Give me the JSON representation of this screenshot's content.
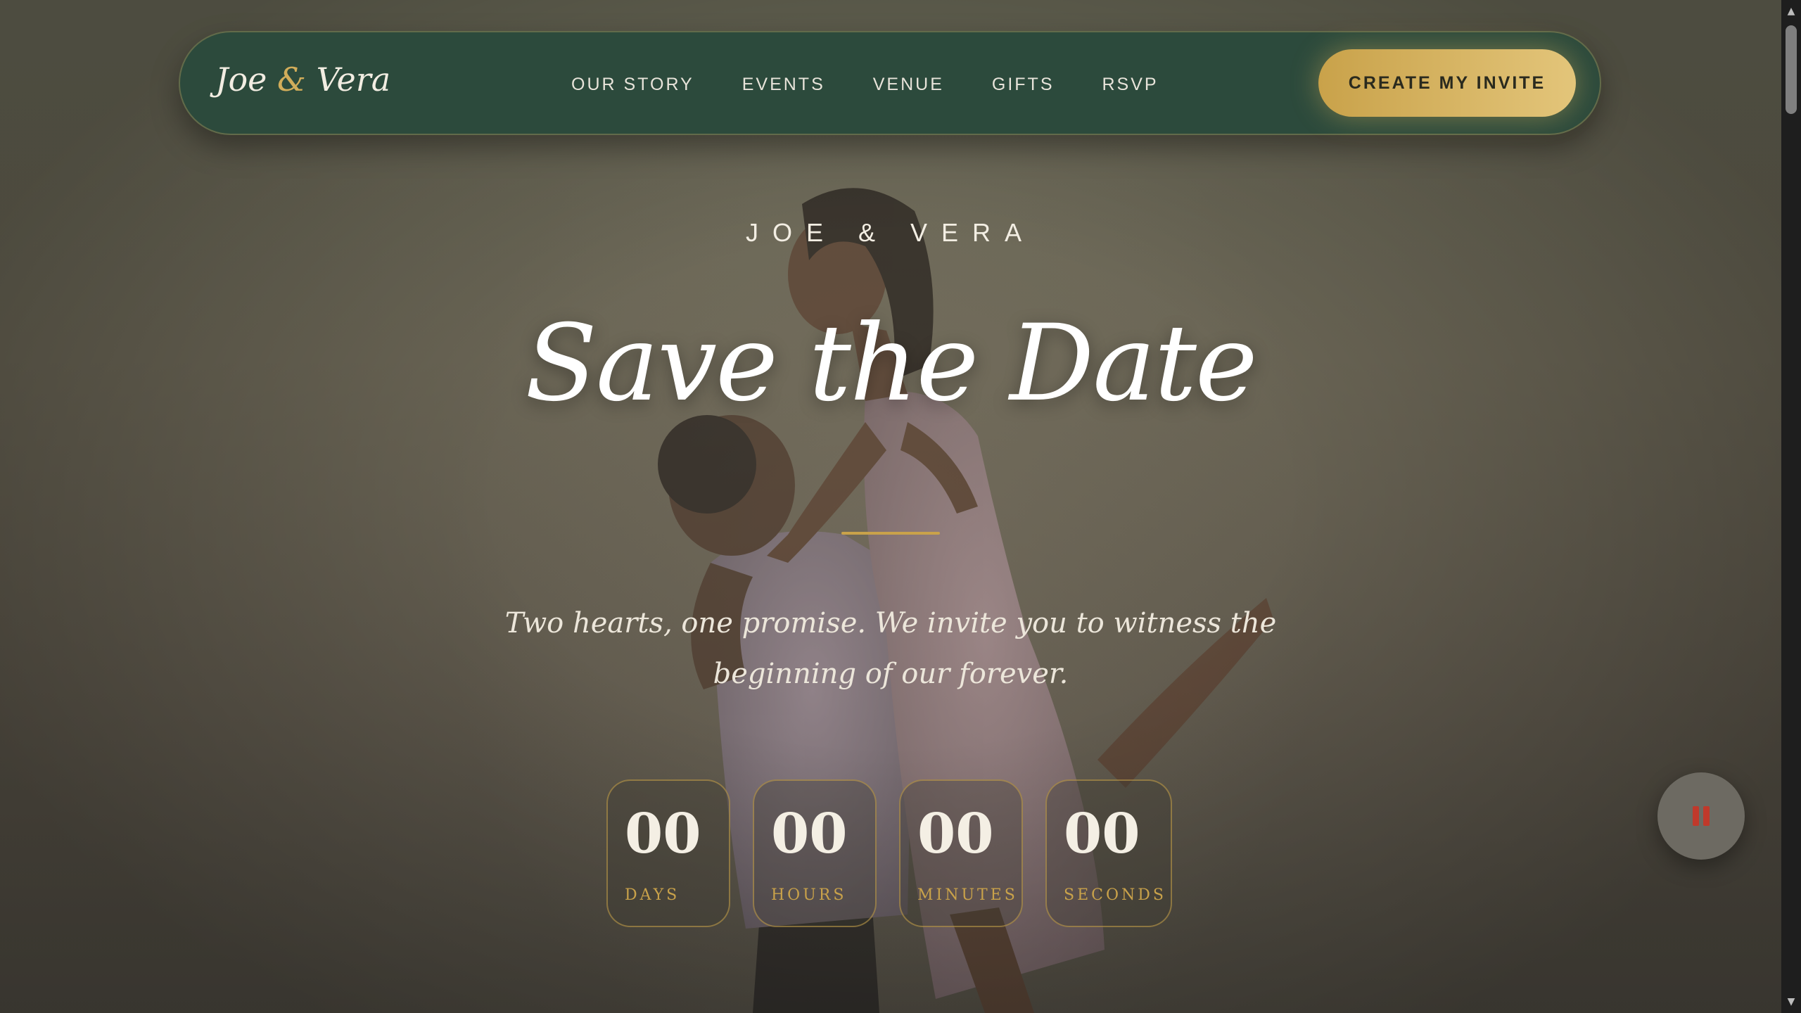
{
  "navbar": {
    "logo_first": "Joe",
    "logo_amp": "&",
    "logo_second": "Vera",
    "links": [
      {
        "label": "OUR STORY"
      },
      {
        "label": "EVENTS"
      },
      {
        "label": "VENUE"
      },
      {
        "label": "GIFTS"
      },
      {
        "label": "RSVP"
      }
    ],
    "cta_label": "CREATE MY INVITE"
  },
  "hero": {
    "eyebrow": "JOE & VERA",
    "title": "Save the Date",
    "tagline": "Two hearts, one promise. We invite you to witness the beginning of our forever."
  },
  "countdown": [
    {
      "value": "00",
      "label": "DAYS"
    },
    {
      "value": "00",
      "label": "HOURS"
    },
    {
      "value": "00",
      "label": "MINUTES"
    },
    {
      "value": "00",
      "label": "SECONDS"
    }
  ],
  "music_button": {
    "icon": "pause-icon",
    "state": "playing"
  },
  "colors": {
    "nav_bg": "#2c4a3c",
    "accent_gold": "#c9a24a",
    "pause_red": "#c0392b"
  }
}
